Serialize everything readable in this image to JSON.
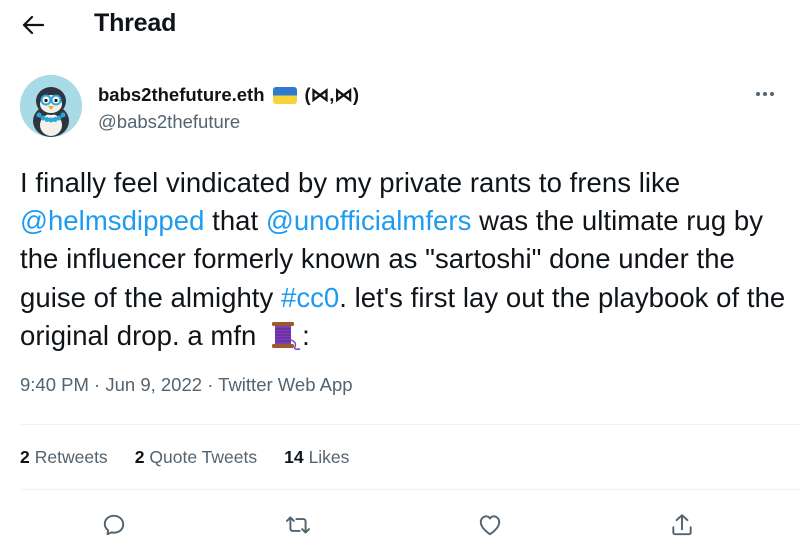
{
  "header": {
    "title": "Thread",
    "back_icon": "arrow-left-icon"
  },
  "author": {
    "display_name": "babs2thefuture.eth",
    "name_suffix": "(⋈,⋈)",
    "handle": "@babs2thefuture",
    "flag_icon": "ukraine-flag-icon",
    "avatar_icon": "penguin-avatar"
  },
  "tweet": {
    "segments": [
      {
        "text": "I finally feel vindicated by my private rants to frens like ",
        "link": false
      },
      {
        "text": "@helmsdipped",
        "link": true
      },
      {
        "text": " that ",
        "link": false
      },
      {
        "text": "@unofficialmfers",
        "link": true
      },
      {
        "text": " was the ultimate rug by the influencer formerly known as \"sartoshi\" done under the guise of the almighty ",
        "link": false
      },
      {
        "text": "#cc0",
        "link": true
      },
      {
        "text": ". let's first lay out the playbook of the original drop. a mfn ",
        "link": false
      }
    ],
    "trailing_emoji": "thread-spool-icon",
    "trailing_text": ":",
    "link_color": "#1d9bf0"
  },
  "meta": {
    "time": "9:40 PM",
    "sep1": " · ",
    "date": "Jun 9, 2022",
    "sep2": " · ",
    "source": "Twitter Web App"
  },
  "stats": {
    "retweets_count": "2",
    "retweets_label": "Retweets",
    "quotes_count": "2",
    "quotes_label": "Quote Tweets",
    "likes_count": "14",
    "likes_label": "Likes"
  },
  "actions": [
    "reply-icon",
    "retweet-icon",
    "like-icon",
    "share-icon"
  ],
  "colors": {
    "text": "#0f1419",
    "secondary": "#536471",
    "accent": "#1d9bf0",
    "divider": "#eff3f4"
  }
}
